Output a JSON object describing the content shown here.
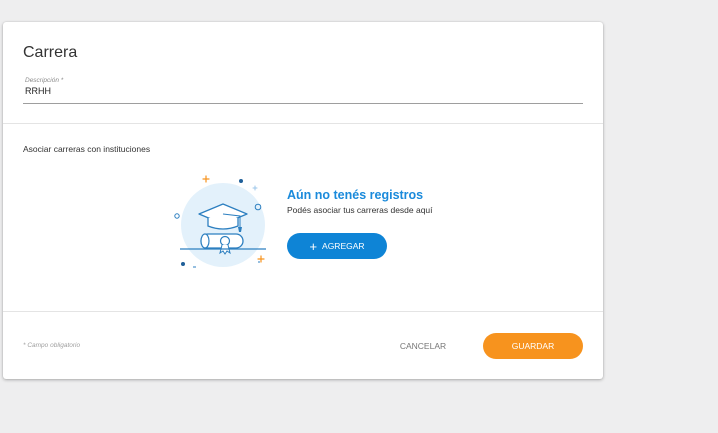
{
  "form": {
    "title": "Carrera",
    "description_label": "Descripción *",
    "description_value": "RRHH"
  },
  "association": {
    "section_label": "Asociar carreras con instituciones",
    "empty_title": "Aún no tenés registros",
    "empty_subtitle": "Podés asociar tus carreras desde aquí",
    "add_label": "AGREGAR",
    "add_icon": "plus-icon",
    "illustration_icon": "graduation-cap-diploma-icon"
  },
  "footer": {
    "required_note": "* Campo obligatorio",
    "cancel_label": "CANCELAR",
    "save_label": "GUARDAR"
  },
  "colors": {
    "accent_blue": "#0e84d6",
    "title_blue": "#1a8adb",
    "save_orange": "#f7931e",
    "illustration_bg": "#e3f1fb",
    "illustration_stroke": "#2c7fc0"
  }
}
